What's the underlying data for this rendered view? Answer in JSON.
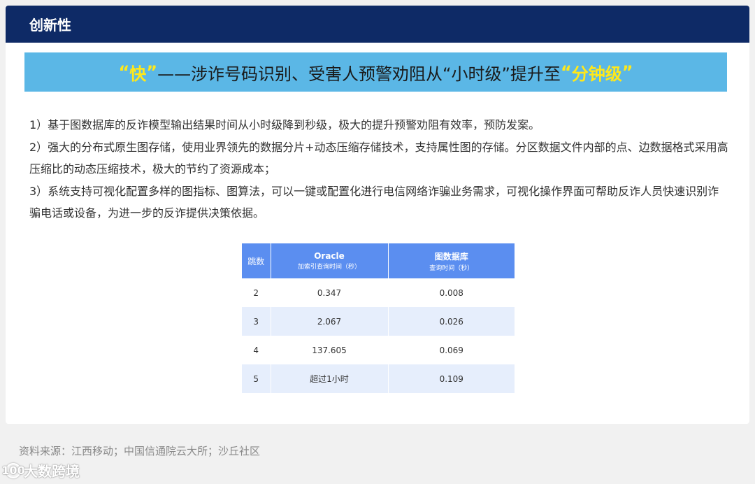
{
  "header": {
    "title": "创新性"
  },
  "banner": {
    "quote_open_1": "“",
    "highlight_1": "快",
    "quote_close_1": "”",
    "middle": "——涉诈号码识别、受害人预警劝阻从“小时级”提升至",
    "quote_open_2": "“",
    "highlight_2": "分钟级",
    "quote_close_2": "”"
  },
  "paragraphs": [
    "1）基于图数据库的反诈模型输出结果时间从小时级降到秒级，极大的提升预警劝阻有效率，预防发案。",
    "2）强大的分布式原生图存储，使用业界领先的数据分片+动态压缩存储技术，支持属性图的存储。分区数据文件内部的点、边数据格式采用高压缩比的动态压缩技术，极大的节约了资源成本；",
    "3）系统支持可视化配置多样的图指标、图算法，可以一键或配置化进行电信网络诈骗业务需求，可视化操作界面可帮助反诈人员快速识别诈骗电话或设备，为进一步的反诈提供决策依据。"
  ],
  "table": {
    "headers": [
      {
        "main": "跳数",
        "sub": ""
      },
      {
        "main": "Oracle",
        "sub": "加索引查询时间（秒）"
      },
      {
        "main": "图数据库",
        "sub": "查询时间（秒）"
      }
    ],
    "rows": [
      [
        "2",
        "0.347",
        "0.008"
      ],
      [
        "3",
        "2.067",
        "0.026"
      ],
      [
        "4",
        "137.605",
        "0.069"
      ],
      [
        "5",
        "超过1小时",
        "0.109"
      ]
    ]
  },
  "footer": {
    "source": "资料来源：江西移动；中国信通院云大所；沙丘社区",
    "watermark_logo": "100",
    "watermark_text": "大数跨境"
  }
}
